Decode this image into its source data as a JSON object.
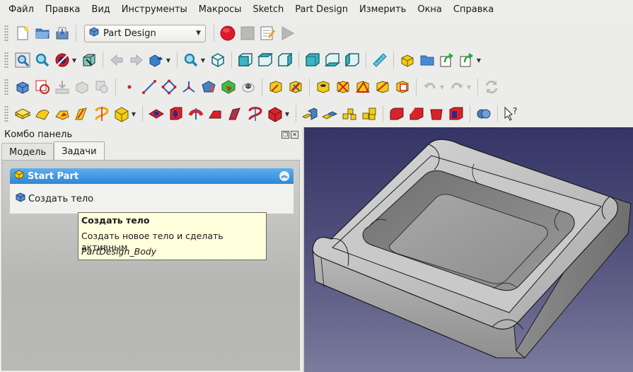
{
  "menubar": {
    "items": [
      "Файл",
      "Правка",
      "Вид",
      "Инструменты",
      "Макросы",
      "Sketch",
      "Part Design",
      "Измерить",
      "Окна",
      "Справка"
    ]
  },
  "toolbar": {
    "workbench_selector": "Part Design"
  },
  "colors": {
    "macro_record": "#e0192c",
    "accent_blue": "#2f86d6",
    "part_yellow": "#f2cc18",
    "partdesign_red": "#d8232a",
    "view_bg_top": "#343466",
    "view_bg_bottom": "#7b7b9d"
  },
  "combo_panel": {
    "title": "Комбо панель",
    "tabs": [
      {
        "label": "Модель",
        "active": false
      },
      {
        "label": "Задачи",
        "active": true
      }
    ],
    "taskbox": {
      "title": "Start Part",
      "action": "Создать тело"
    }
  },
  "tooltip": {
    "title": "Создать тело",
    "description": "Создать новое тело и сделать активным",
    "command": "PartDesign_Body"
  }
}
